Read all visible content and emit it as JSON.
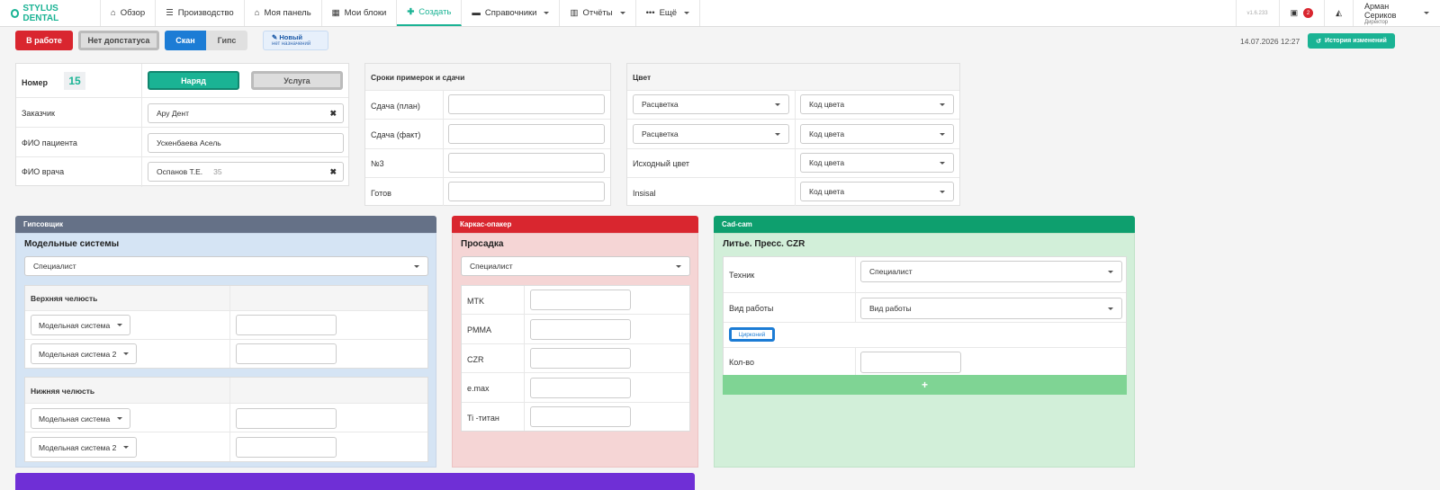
{
  "app": {
    "logo": "STYLUS DENTAL",
    "version": "v1.6.233",
    "notif_count": "2"
  },
  "nav": [
    {
      "label": "Обзор",
      "icon": "home-icon"
    },
    {
      "label": "Производство",
      "icon": "list-icon"
    },
    {
      "label": "Моя панель",
      "icon": "home-icon"
    },
    {
      "label": "Мои блоки",
      "icon": "grid-icon"
    },
    {
      "label": "Создать",
      "icon": "plus-icon"
    },
    {
      "label": "Справочники",
      "icon": "book-icon"
    },
    {
      "label": "Отчёты",
      "icon": "chart-icon"
    },
    {
      "label": "Ещё",
      "icon": "ellipsis-icon"
    }
  ],
  "user": {
    "name": "Арман Сериков",
    "role": "Директор"
  },
  "statusbar": {
    "in_work": "В работе",
    "no_status": "Нет допстатуса",
    "scan": "Скан",
    "plaster": "Гипс",
    "new_label": "Новый",
    "new_sub": "нет назначений",
    "datetime": "14.07.2026 12:27",
    "history": "История изменений"
  },
  "order": {
    "number_label": "Номер",
    "number": "15",
    "btn_order": "Наряд",
    "btn_service": "Услуга",
    "customer_label": "Заказчик",
    "customer": "Ару Дент",
    "patient_label": "ФИО пациента",
    "patient": "Ускенбаева Асель",
    "doctor_label": "ФИО врача",
    "doctor": "Оспанов Т.Е.",
    "doctor_num": "35"
  },
  "dates": {
    "title": "Сроки примерок и сдачи",
    "rows": [
      "Сдача (план)",
      "Сдача (факт)",
      "№3",
      "Готов"
    ]
  },
  "color": {
    "title": "Цвет",
    "shade": "Расцветка",
    "code": "Код цвета",
    "source": "Исходный цвет",
    "insisal": "Insisal"
  },
  "plaster": {
    "header": "Гипсовщик",
    "title": "Модельные системы",
    "specialist": "Специалист",
    "upper": "Верхняя челюсть",
    "lower": "Нижняя челюсть",
    "ms1": "Модельная система",
    "ms2": "Модельная система 2"
  },
  "frame": {
    "header": "Каркас-опакер",
    "title": "Просадка",
    "specialist": "Специалист",
    "rows": [
      "MTK",
      "PMMA",
      "CZR",
      "e.max",
      "Ti -титан"
    ]
  },
  "cadcam": {
    "header": "Cad-cam",
    "title": "Литье. Пресс. CZR",
    "tech_label": "Техник",
    "specialist": "Специалист",
    "work_label": "Вид работы",
    "work": "Вид работы",
    "tag": "Цирконий",
    "qty_label": "Кол-во",
    "add": "+"
  },
  "colors": {
    "teal": "#1ab394",
    "red": "#d9262f",
    "blue": "#1c7cd5",
    "slate": "#657187",
    "green": "#0e9f6e",
    "purple": "#6f2fd6"
  }
}
